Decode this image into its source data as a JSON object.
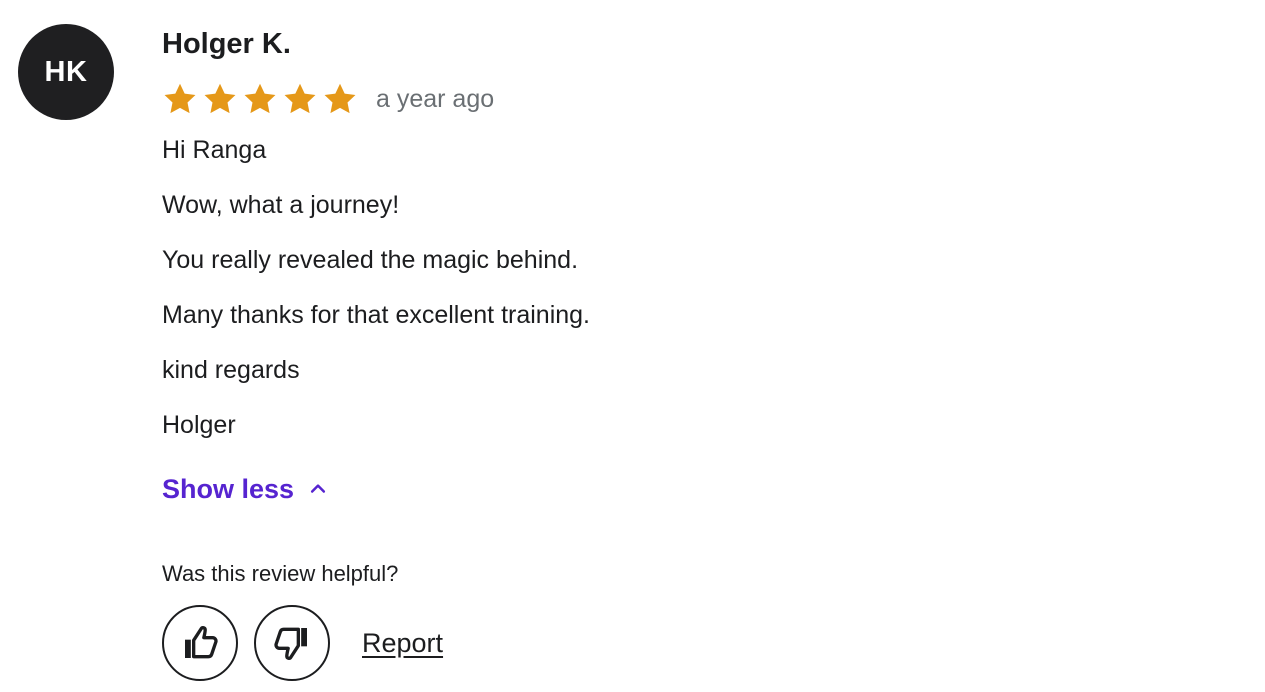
{
  "review": {
    "avatar_initials": "HK",
    "author_name": "Holger K.",
    "rating": 5,
    "rating_max": 5,
    "time_ago": "a year ago",
    "lines": [
      "Hi Ranga",
      "Wow, what a journey!",
      "You really revealed the magic behind.",
      "Many thanks for that excellent training.",
      "kind regards",
      "Holger"
    ],
    "show_less_label": "Show less",
    "helpful_question": "Was this review helpful?",
    "report_label": "Report"
  },
  "colors": {
    "star": "#e59819",
    "accent": "#5624d0",
    "avatar_bg": "#1f1f21",
    "muted_text": "#6a6f73"
  },
  "icons": {
    "star": "star-icon",
    "chevron": "chevron-up-icon",
    "thumbs_up": "thumbs-up-icon",
    "thumbs_down": "thumbs-down-icon"
  }
}
